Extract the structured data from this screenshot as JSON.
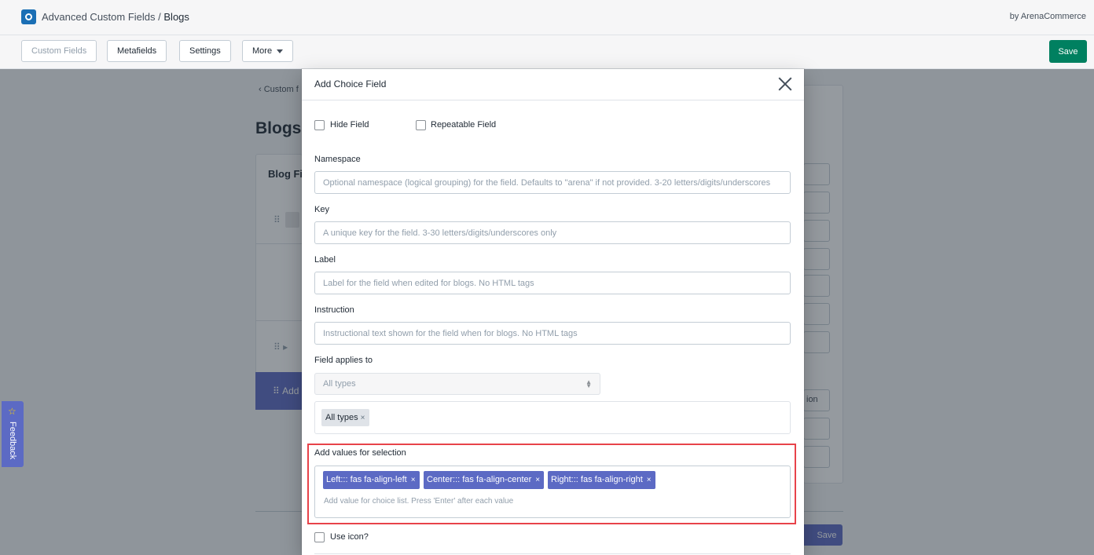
{
  "header": {
    "app_name": "Advanced Custom Fields",
    "separator": "/",
    "current_page": "Blogs",
    "byline": "by ArenaCommerce"
  },
  "toolbar": {
    "custom_fields": "Custom Fields",
    "metafields": "Metafields",
    "settings": "Settings",
    "more": "More",
    "save": "Save"
  },
  "background": {
    "back_link": "Custom f",
    "page_title": "Blogs",
    "card_title": "Blog Fi",
    "add_label": "Add",
    "right_tail": "ion",
    "footer_save": "Save"
  },
  "feedback": {
    "label": "Feedback"
  },
  "modal": {
    "title": "Add Choice Field",
    "hide_field": "Hide Field",
    "repeatable_field": "Repeatable Field",
    "namespace": {
      "label": "Namespace",
      "placeholder": "Optional namespace (logical grouping) for the field. Defaults to \"arena\" if not provided. 3-20 letters/digits/underscores"
    },
    "key": {
      "label": "Key",
      "placeholder": "A unique key for the field. 3-30 letters/digits/underscores only"
    },
    "label_field": {
      "label": "Label",
      "placeholder": "Label for the field when edited for blogs. No HTML tags"
    },
    "instruction": {
      "label": "Instruction",
      "placeholder": "Instructional text shown for the field when for blogs. No HTML tags"
    },
    "applies_to": {
      "label": "Field applies to",
      "selected": "All types",
      "tags": [
        "All types"
      ]
    },
    "values": {
      "label": "Add values for selection",
      "tags": [
        "Left::: fas fa-align-left",
        "Center::: fas fa-align-center",
        "Right::: fas fa-align-right"
      ],
      "placeholder": "Add value for choice list. Press 'Enter' after each value",
      "highlight_color": "#e8434a",
      "tag_color": "#5c6ac4"
    },
    "use_icon": "Use icon?"
  },
  "colors": {
    "primary_green": "#008060",
    "indigo": "#5c6ac4"
  }
}
